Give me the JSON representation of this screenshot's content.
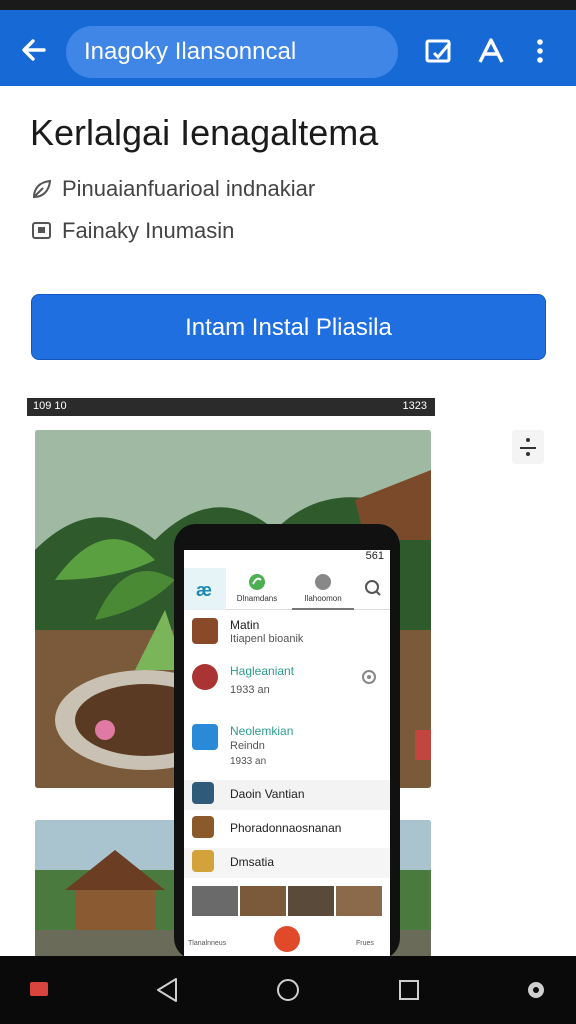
{
  "status_bar": {
    "left": "",
    "right": ""
  },
  "app_bar": {
    "search_text": "Inagoky Ilansonncal"
  },
  "page": {
    "title": "Kerlalgai Ienagaltema",
    "meta_developer": "Pinuaianfuarioal indnakiar",
    "meta_category": "Fainaky Inumasin",
    "install_label": "Intam Instal Pliasila"
  },
  "screenshot": {
    "status_left": "109 10",
    "status_right": "1323",
    "phone": {
      "status": "561",
      "tabs": [
        "Dlnamdans",
        "Ilahoomon"
      ],
      "items": [
        {
          "title": "Matin",
          "subtitle": "Itiapenl bioanik"
        },
        {
          "title": "Hagleaniant",
          "subtitle": "1933 an"
        },
        {
          "title": "Neolemkian",
          "subtitle": "Reindn",
          "meta": "1933 an"
        },
        {
          "title": "Daoin Vantian"
        },
        {
          "title": "Phoradonnaosnanan"
        },
        {
          "title": "Dmsatia"
        }
      ],
      "bottom_left": "Tlanalnneus",
      "bottom_right": "Frues"
    }
  },
  "colors": {
    "accent": "#1769d6",
    "button": "#1f6fe0"
  }
}
